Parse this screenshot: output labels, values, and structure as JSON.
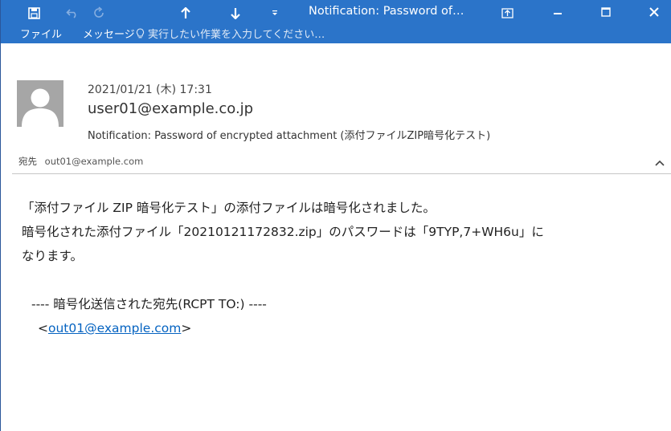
{
  "window": {
    "title": "Notification: Password of…",
    "icons": {
      "save": "save-icon",
      "undo": "undo-icon",
      "redo": "redo-icon",
      "previous": "arrow-up-icon",
      "next": "arrow-down-icon",
      "customize": "customize-qat-icon",
      "ribbon_options": "ribbon-display-icon",
      "minimize": "minimize-icon",
      "maximize": "maximize-icon",
      "close": "close-icon"
    },
    "accent": "#2b74c9"
  },
  "ribbon": {
    "tabs": [
      "ファイル",
      "メッセージ"
    ],
    "tell_me_placeholder": "実行したい作業を入力してください…"
  },
  "message": {
    "date": "2021/01/21 (木) 17:31",
    "sender": "user01@example.co.jp",
    "subject": "Notification: Password of encrypted attachment (添付ファイルZIP暗号化テスト)",
    "to_label": "宛先",
    "to_address": "out01@example.com",
    "body": {
      "line1": "「添付ファイル ZIP 暗号化テスト」の添付ファイルは暗号化されました。",
      "line2": "暗号化された添付ファイル「20210121172832.zip」のパスワードは「9TYP,7+WH6u」に",
      "line3": "なります。",
      "line4": "---- 暗号化送信された宛先(RCPT TO:) ----",
      "recipient_open": "<",
      "recipient_link": "out01@example.com",
      "recipient_close": ">"
    },
    "link_color": "#0563c1"
  }
}
